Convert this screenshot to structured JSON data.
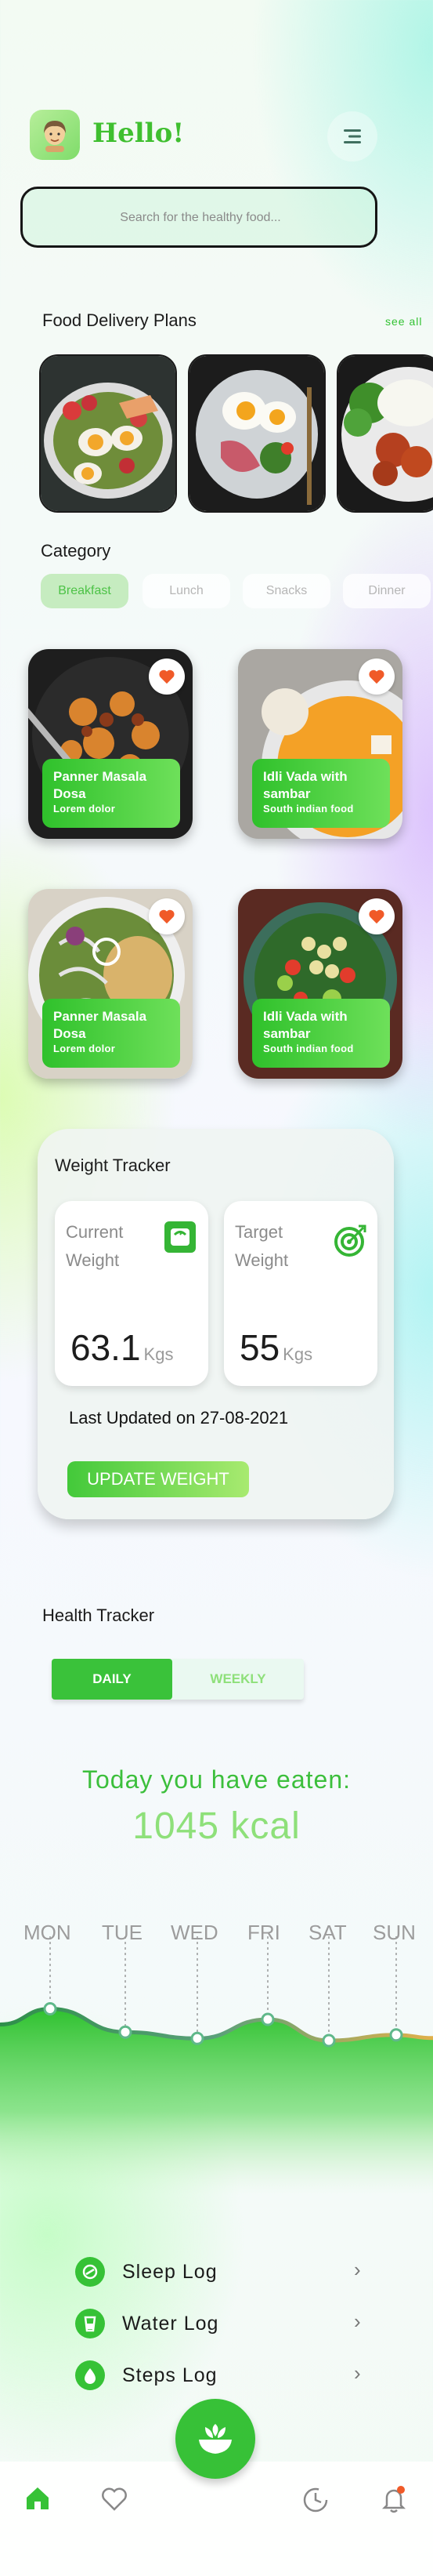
{
  "header": {
    "greeting": "Hello!",
    "avatar_icon": "avatar-icon",
    "menu_icon": "menu-icon"
  },
  "search": {
    "placeholder": "Search for the healthy food..."
  },
  "plans": {
    "title": "Food Delivery Plans",
    "see_all": "see all",
    "items": [
      "salad-egg-plate",
      "egg-breakfast-plate",
      "chicken-rice-plate"
    ]
  },
  "category": {
    "title": "Category",
    "chips": [
      {
        "label": "Breakfast",
        "active": true
      },
      {
        "label": "Lunch",
        "active": false
      },
      {
        "label": "Snacks",
        "active": false
      },
      {
        "label": "Dinner",
        "active": false
      }
    ]
  },
  "foods": [
    {
      "name": "Panner Masala Dosa",
      "subtitle": "Lorem dolor"
    },
    {
      "name": "Idli Vada with sambar",
      "subtitle": "South indian food"
    },
    {
      "name": "Panner Masala Dosa",
      "subtitle": "Lorem dolor"
    },
    {
      "name": "Idli Vada with sambar",
      "subtitle": "South indian food"
    }
  ],
  "weight": {
    "title": "Weight Tracker",
    "current": {
      "label": "Current Weight",
      "value": "63.1",
      "unit": "Kgs"
    },
    "target": {
      "label": "Target Weight",
      "value": "55",
      "unit": "Kgs"
    },
    "last_updated": "Last Updated on 27-08-2021",
    "button": "UPDATE WEIGHT"
  },
  "health": {
    "title": "Health Tracker",
    "tabs": [
      {
        "label": "DAILY",
        "active": true
      },
      {
        "label": "WEEKLY",
        "active": false
      }
    ],
    "eaten_label": "Today you have eaten:",
    "kcal": "1045 kcal",
    "days": [
      "MON",
      "TUE",
      "WED",
      "FRI",
      "SAT",
      "SUN"
    ],
    "levels": [
      0.75,
      0.42,
      0.33,
      0.6,
      0.3,
      0.38
    ]
  },
  "logs": [
    {
      "label": "Sleep Log",
      "icon": "sleep-icon"
    },
    {
      "label": "Water Log",
      "icon": "water-icon"
    },
    {
      "label": "Steps Log",
      "icon": "steps-icon"
    }
  ],
  "nav": {
    "items": [
      "home-icon",
      "heart-icon",
      "food-bowl-icon",
      "history-icon",
      "bell-icon"
    ]
  },
  "colors": {
    "accent": "#3fbf2f",
    "accent_light": "#8ee07a",
    "heart": "#f05a28"
  }
}
